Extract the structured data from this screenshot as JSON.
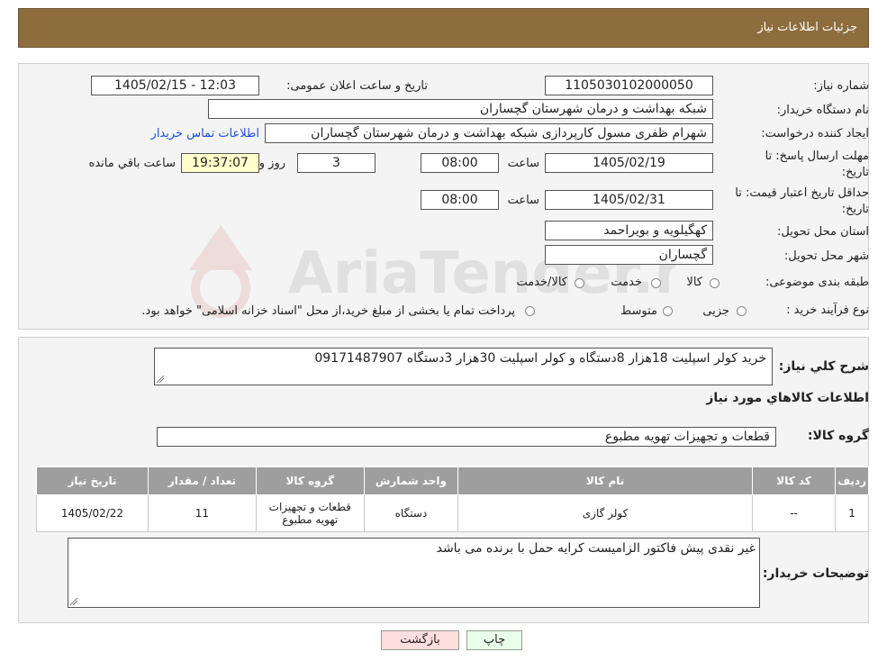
{
  "page_title": "جزئیات اطلاعات نیاز",
  "fields": {
    "need_number_label": "شماره نیاز:",
    "need_number": "1105030102000050",
    "announce_datetime_label": "تاریخ و ساعت اعلان عمومی:",
    "announce_datetime": "1405/02/15 - 12:03",
    "buyer_org_label": "نام دستگاه خریدار:",
    "buyer_org": "شبکه بهداشت و درمان شهرستان گچساران",
    "requester_label": "ایجاد کننده درخواست:",
    "requester": "شهرام ظفری مسول کارپردازی  شبکه بهداشت و درمان شهرستان گچساران",
    "buyer_contact_link": "اطلاعات تماس خریدار",
    "reply_deadline_label_1": "مهلت ارسال پاسخ: تا",
    "reply_deadline_label_2": "تاریخ:",
    "reply_date": "1405/02/19",
    "time_label": "ساعت",
    "reply_time": "08:00",
    "remaining_days": "3",
    "days_and_label": "روز و",
    "remaining_time": "19:37:07",
    "remaining_label": "ساعت باقي مانده",
    "price_validity_label_1": "حداقل تاریخ اعتبار قیمت: تا",
    "price_validity_label_2": "تاریخ:",
    "price_validity_date": "1405/02/31",
    "price_validity_time": "08:00",
    "province_label": "استان محل تحویل:",
    "province": "کهگیلویه و بویراحمد",
    "city_label": "شهر محل تحویل:",
    "city": "گچساران",
    "category_label": "طبقه بندی موضوعی:",
    "category_options": [
      "کالا",
      "خدمت",
      "کالا/خدمت"
    ],
    "process_label": "نوع فرآیند خرید :",
    "process_options": [
      "جزیی",
      "متوسط"
    ],
    "process_note": "پرداخت تمام یا بخشی از مبلغ خرید،از محل \"اسناد خزانه اسلامی\" خواهد بود."
  },
  "description_label": "شرح کلي نياز:",
  "description": "خرید کولر اسپلیت 18هزار 8دستگاه و کولر اسپلیت 30هزار 3دستگاه  09171487907",
  "goods_section_title": "اطلاعات کالاهاي مورد نياز",
  "goods_group_label": "گروه کالا:",
  "goods_group": "قطعات و تجهیزات تهویه مطبوع",
  "table": {
    "headers": [
      "رديف",
      "کد کالا",
      "نام کالا",
      "واحد شمارش",
      "گروه کالا",
      "تعداد / مقدار",
      "تاریخ نیاز"
    ],
    "rows": [
      [
        "1",
        "--",
        "کولر گازی",
        "دستگاه",
        "قطعات و تجهیزات تهویه مطبوع",
        "11",
        "1405/02/22"
      ]
    ]
  },
  "buyer_notes_label": "توضیحات خریدار:",
  "buyer_notes": "غیر نقدی پیش فاکتور الزامیست کرایه حمل با برنده می باشد",
  "buttons": {
    "print": "چاپ",
    "back": "بازگشت"
  },
  "watermark_text": "AriaTender.neT",
  "colors": {
    "header": "#8d6d3d",
    "table_header": "#9e9e9e",
    "yellow_box": "#ffffcc",
    "back_button": "#ffdede",
    "print_button": "#eaffea"
  }
}
